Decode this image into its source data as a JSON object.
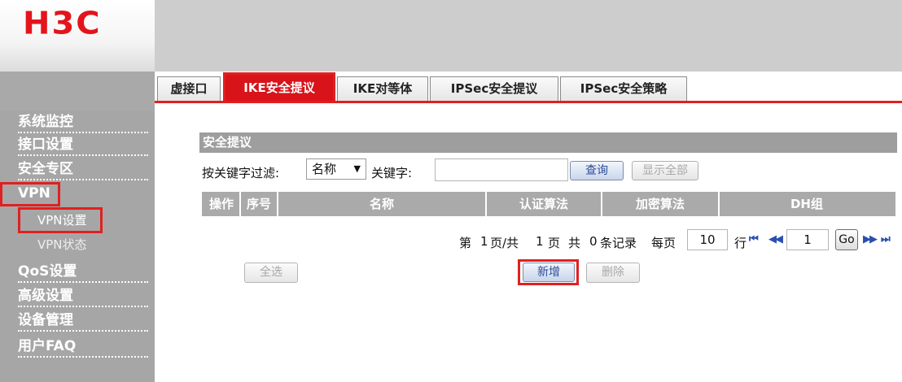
{
  "brand": {
    "logo": "H3C",
    "accent": "#e3141b"
  },
  "sidebar": {
    "items": [
      {
        "label": "系统监控"
      },
      {
        "label": "接口设置"
      },
      {
        "label": "安全专区"
      },
      {
        "label": "VPN",
        "selected": true
      },
      {
        "label": "QoS设置"
      },
      {
        "label": "高级设置"
      },
      {
        "label": "设备管理"
      },
      {
        "label": "用户FAQ"
      }
    ],
    "subitems": [
      {
        "label": "VPN设置",
        "selected": true
      },
      {
        "label": "VPN状态"
      }
    ]
  },
  "tabs": [
    {
      "label": "虚接口"
    },
    {
      "label": "IKE安全提议",
      "active": true
    },
    {
      "label": "IKE对等体"
    },
    {
      "label": "IPSec安全提议"
    },
    {
      "label": "IPSec安全策略"
    }
  ],
  "section": {
    "title": "安全提议",
    "filter_label": "按关键字过滤:",
    "filter_select": "名称",
    "keyword_label": "关键字:",
    "keyword_value": "",
    "query_button": "查询",
    "show_all_button": "显示全部"
  },
  "table": {
    "columns": [
      "操作",
      "序号",
      "名称",
      "认证算法",
      "加密算法",
      "DH组"
    ],
    "rows": []
  },
  "paging": {
    "text_prefix": "第",
    "current_page": "1",
    "text_page_total_prefix": "页/共",
    "total_pages": "1",
    "text_page_total_suffix": "页",
    "text_total": "共",
    "record_count": "0",
    "text_records": "条记录",
    "text_per_page": "每页",
    "per_page": "10",
    "text_row": "行",
    "goto_page": "1",
    "go_button": "Go",
    "first_icon": "⏮",
    "prev_icon": "◀◀",
    "next_icon": "▶▶",
    "last_icon": "⏭"
  },
  "actions": {
    "select_all": "全选",
    "add": "新增",
    "delete": "删除"
  }
}
